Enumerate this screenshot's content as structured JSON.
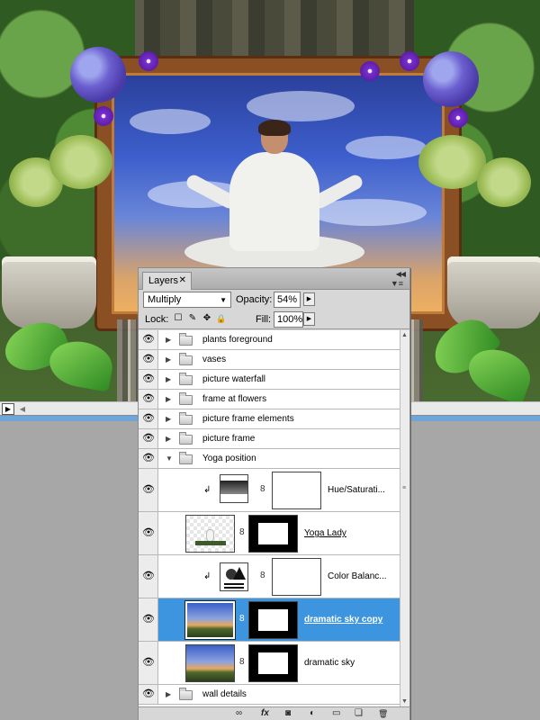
{
  "canvas": {
    "description_icons": [
      "woman-figure",
      "picture-frame",
      "hydrangea",
      "vase",
      "hosta"
    ]
  },
  "scrollbar": {
    "play_glyph": "▶",
    "left_glyph": "◀"
  },
  "panel": {
    "tab_label": "Layers",
    "tab_close": "✕",
    "collapse_glyph": "◀◀",
    "menu_glyph": "▼≡",
    "blend_mode": "Multiply",
    "blend_dropdown_glyph": "▼",
    "opacity_label": "Opacity:",
    "opacity_value": "54%",
    "spin_glyph": "▶",
    "lock_label": "Lock:",
    "lock_icons": [
      "☐",
      "✎",
      "✥",
      "🔒"
    ],
    "fill_label": "Fill:",
    "fill_value": "100%"
  },
  "layers": [
    {
      "name": "plants foreground",
      "type": "group",
      "expanded": false
    },
    {
      "name": "vases",
      "type": "group",
      "expanded": false
    },
    {
      "name": "picture waterfall",
      "type": "group",
      "expanded": false
    },
    {
      "name": "frame at flowers",
      "type": "group",
      "expanded": false
    },
    {
      "name": "picture frame elements",
      "type": "group",
      "expanded": false
    },
    {
      "name": "picture frame",
      "type": "group",
      "expanded": false
    },
    {
      "name": "Yoga position",
      "type": "group",
      "expanded": true
    },
    {
      "name": "Hue/Saturati...",
      "type": "adjustment",
      "clipped": true
    },
    {
      "name": "Yoga Lady",
      "type": "pixel",
      "underline": true
    },
    {
      "name": "Color Balanc...",
      "type": "adjustment",
      "clipped": true
    },
    {
      "name": "dramatic sky copy",
      "type": "pixel",
      "selected": true
    },
    {
      "name": "dramatic sky",
      "type": "pixel"
    },
    {
      "name": "wall details",
      "type": "group",
      "expanded": false
    }
  ],
  "glyphs": {
    "eye": "👁",
    "tri_collapsed": "▶",
    "tri_expanded": "▼",
    "clip": "↲",
    "link": "8"
  },
  "footer": {
    "icons": [
      "∞",
      "fx",
      "◙",
      "◐",
      "▭",
      "❏",
      "🗑"
    ]
  }
}
